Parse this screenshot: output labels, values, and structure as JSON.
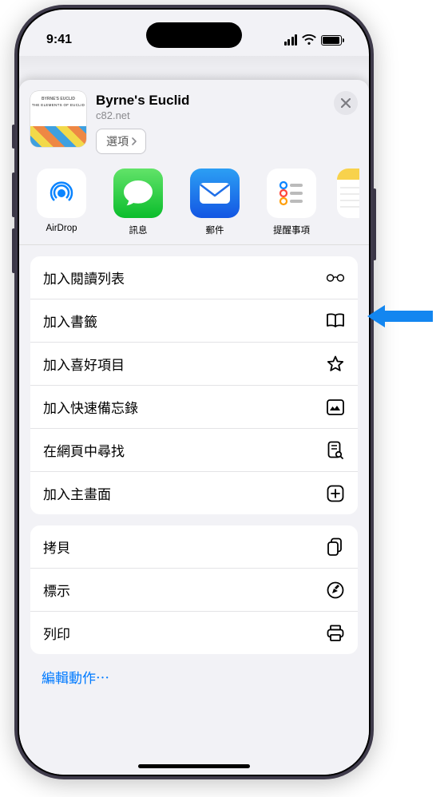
{
  "status": {
    "time": "9:41"
  },
  "header": {
    "title": "Byrne's Euclid",
    "subtitle": "c82.net",
    "options_label": "選項",
    "thumb_line1": "BYRNE'S EUCLID",
    "thumb_line2": "THE ELEMENTS OF EUCLID"
  },
  "apps": [
    {
      "label": "AirDrop",
      "icon": "airdrop"
    },
    {
      "label": "訊息",
      "icon": "messages"
    },
    {
      "label": "郵件",
      "icon": "mail"
    },
    {
      "label": "提醒事項",
      "icon": "reminders"
    },
    {
      "label": "",
      "icon": "notes"
    }
  ],
  "group1": [
    {
      "label": "加入閱讀列表",
      "icon": "glasses"
    },
    {
      "label": "加入書籤",
      "icon": "book"
    },
    {
      "label": "加入喜好項目",
      "icon": "star"
    },
    {
      "label": "加入快速備忘錄",
      "icon": "quicknote"
    },
    {
      "label": "在網頁中尋找",
      "icon": "doc-search"
    },
    {
      "label": "加入主畫面",
      "icon": "plus-square"
    }
  ],
  "group2": [
    {
      "label": "拷貝",
      "icon": "docs"
    },
    {
      "label": "標示",
      "icon": "markup"
    },
    {
      "label": "列印",
      "icon": "print"
    }
  ],
  "edit_actions_label": "編輯動作⋯"
}
